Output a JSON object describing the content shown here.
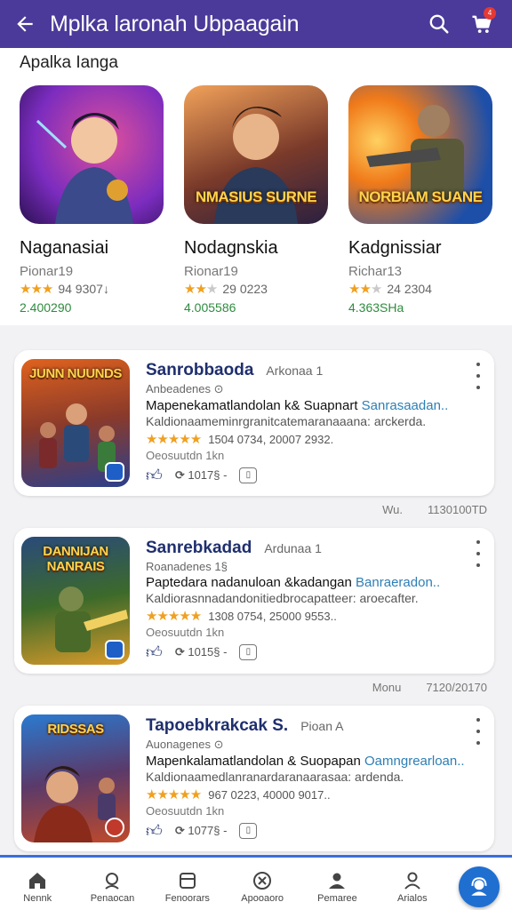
{
  "app_bar": {
    "title": "Mplka laronah Ubpaagain",
    "cart_badge": "4"
  },
  "featured": {
    "section_title": "Apalka Ianga",
    "items": [
      {
        "name": "Naganasiai",
        "developer": "Pionar19",
        "rating_text": "94 9307↓",
        "installs": "2.400290",
        "art_label": "",
        "colors": [
          "#7b2cbf",
          "#e0509a"
        ]
      },
      {
        "name": "Nodagnskia",
        "developer": "Rionar19",
        "rating_text": "29 0223",
        "installs": "4.005586",
        "art_label": "NMASIUS SURNE",
        "colors": [
          "#d96a2b",
          "#3b2a5a"
        ]
      },
      {
        "name": "Kadgnissiar",
        "developer": "Richar13",
        "rating_text": "24 2304",
        "installs": "4.363SHa",
        "art_label": "NORBIAM SUANE",
        "colors": [
          "#1e4fa8",
          "#f07a1a"
        ]
      }
    ]
  },
  "list": [
    {
      "name": "Sanrobbaoda",
      "tag": "Arkonaa 1",
      "subtitle": "Anbeadenes ⊙",
      "desc_main": "Mapenekamatlandolan k& Suapnart ",
      "desc_highlight": "Sanrasaadan..",
      "desc_line2": "Kaldionaameminrgranitcatemaranaaana: arckerda.",
      "rating_text": "1504 0734, 20007 2932.",
      "size": "Oeosuutdn   1kn",
      "likes": "1017§ -",
      "thumb_label": "JUNN NUUNDS",
      "colors": [
        "#e0621e",
        "#2c3f8c"
      ]
    },
    {
      "name": "Sanrebkadad",
      "tag": "Ardunaa 1",
      "subtitle": "Roanadenes 1§",
      "desc_main": "Paptedara nadanuloan &kadangan ",
      "desc_highlight": "Banraeradon..",
      "desc_line2": "Kaldiorasnnadandonitiedbrocapatteer: aroecafter.",
      "rating_text": "1308 0754, 25000 9553..",
      "size": "Oeosuutdn   1kn",
      "likes": "1015§ -",
      "thumb_label": "DANNIJAN NANRAIS",
      "colors": [
        "#3c6a2a",
        "#d99a2a"
      ]
    },
    {
      "name": "Tapoebkrakcak S.",
      "tag": "Pioan A",
      "subtitle": "Auonagenes ⊙",
      "desc_main": "Mapenkalamatlandolan & Suopapan ",
      "desc_highlight": "Oamngrearloan..",
      "desc_line2": "Kaldionaamedlanranardaranaarasaa: ardenda.",
      "rating_text": "967 0223, 40000 9017..",
      "size": "Oeosuutdn   1kn",
      "likes": "1077§ -",
      "thumb_label": "RIDSSAS",
      "colors": [
        "#2a7ad0",
        "#c04a2a"
      ]
    }
  ],
  "meta_rows": [
    {
      "left": "Wu.",
      "right": "1130100TD"
    },
    {
      "left": "Monu",
      "right": "7120/20170"
    }
  ],
  "bottom_nav": [
    {
      "label": "Nennk",
      "icon": "home-icon"
    },
    {
      "label": "Penaocan",
      "icon": "person-chat-icon"
    },
    {
      "label": "Fenoorars",
      "icon": "card-icon"
    },
    {
      "label": "Apooaoro",
      "icon": "close-circle-icon"
    },
    {
      "label": "Pemaree",
      "icon": "profile-icon"
    },
    {
      "label": "Arialos",
      "icon": "account-icon"
    }
  ],
  "accent_colors": {
    "app_bar": "#4b3a9a",
    "link": "#2d7fb5",
    "installs": "#2e8b3e",
    "nav_accent": "#1f6fd1"
  }
}
